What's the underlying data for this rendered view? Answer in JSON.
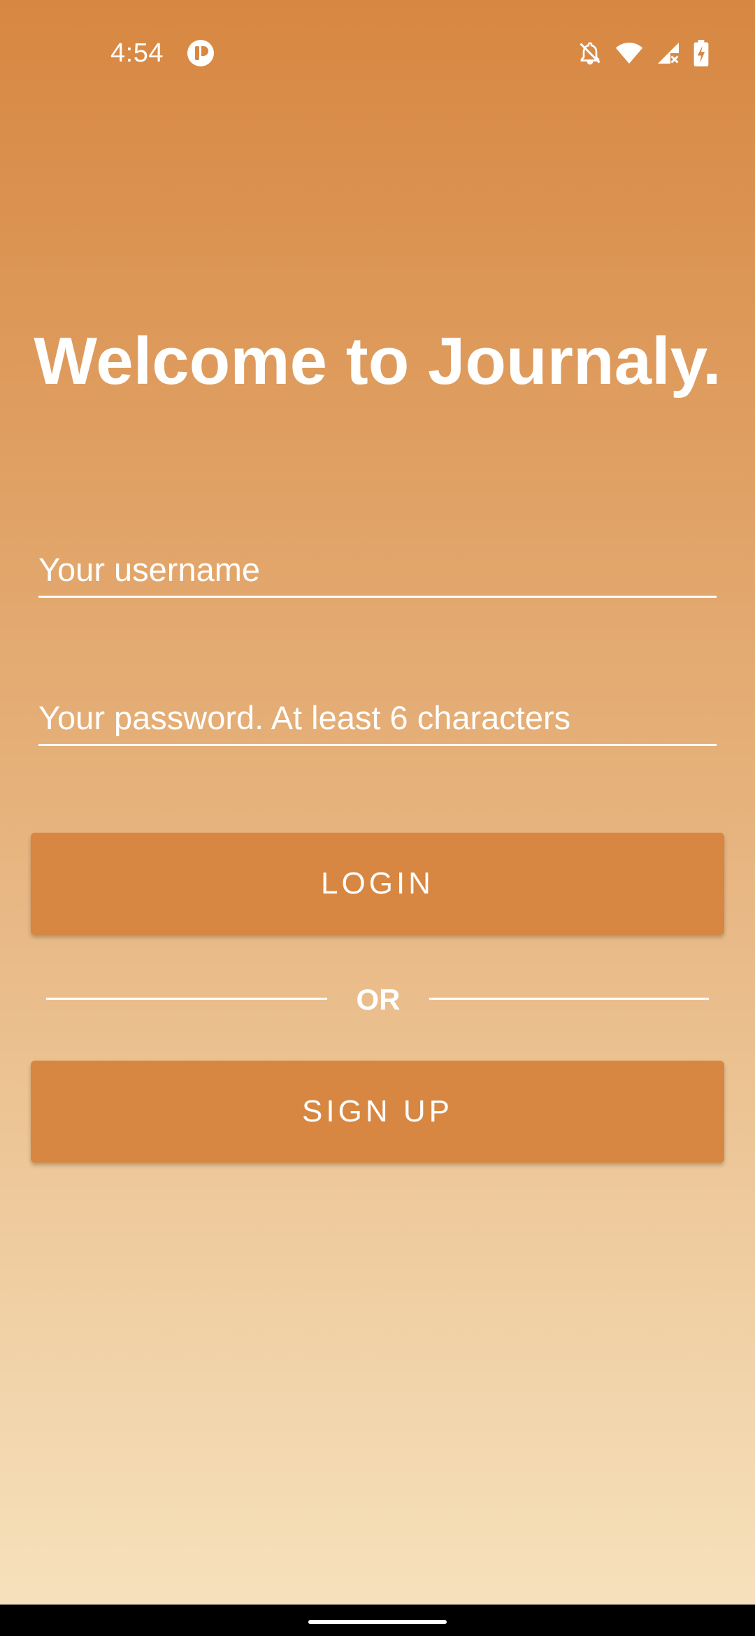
{
  "status_bar": {
    "time": "4:54",
    "icons": [
      "app-notification-icon",
      "bell-off-icon",
      "wifi-icon",
      "signal-no-data-icon",
      "battery-charging-icon"
    ]
  },
  "welcome": {
    "title": "Welcome to Journaly."
  },
  "form": {
    "username_placeholder": "Your username",
    "username_value": "",
    "password_placeholder": "Your password. At least 6 characters",
    "password_value": "",
    "login_label": "LOGIN",
    "or_label": "OR",
    "signup_label": "SIGN UP"
  },
  "colors": {
    "accent": "#d78741",
    "gradient_top": "#d78741",
    "gradient_bottom": "#f6e1bc",
    "text": "#ffffff"
  }
}
